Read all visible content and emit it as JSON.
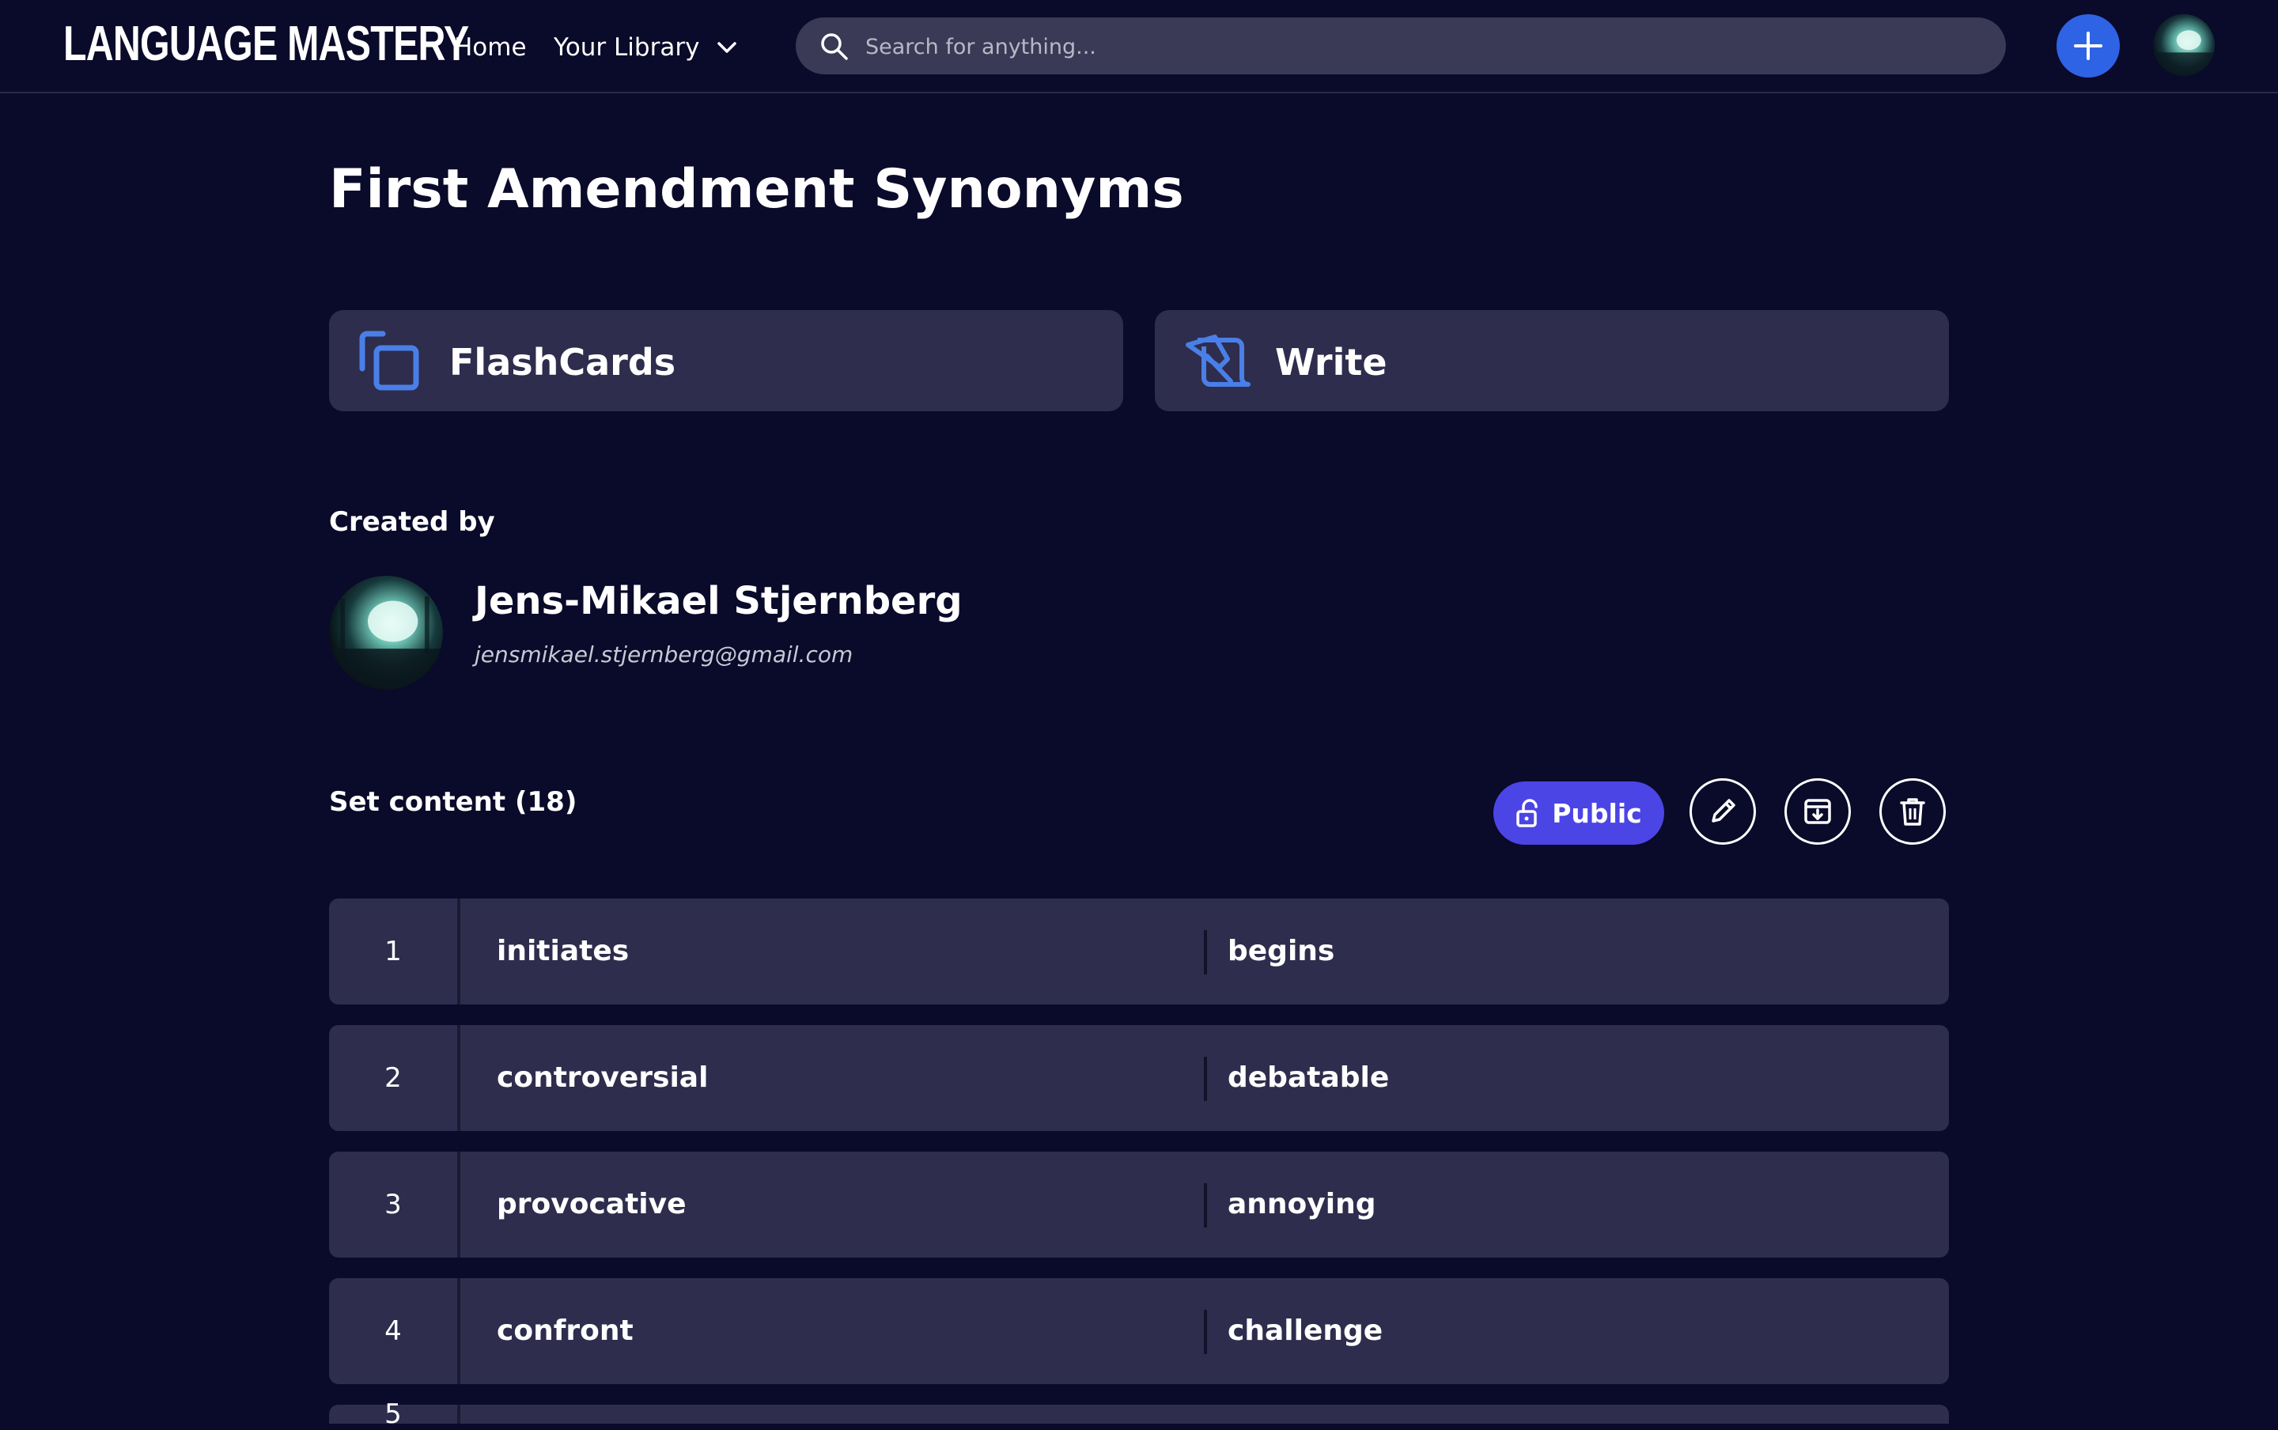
{
  "header": {
    "logo": "LANGUAGE MASTERY",
    "nav": {
      "home": "Home",
      "library": "Your Library"
    },
    "search": {
      "placeholder": "Search for anything..."
    }
  },
  "set": {
    "title": "First Amendment Synonyms",
    "modes": [
      {
        "label": "FlashCards",
        "icon": "flashcards-icon"
      },
      {
        "label": "Write",
        "icon": "write-icon"
      }
    ],
    "created_by_label": "Created by",
    "author": {
      "name": "Jens-Mikael Stjernberg",
      "email": "jensmikael.stjernberg@gmail.com"
    },
    "content_label": "Set content (18)",
    "visibility_label": "Public",
    "terms": [
      {
        "num": "1",
        "term": "initiates",
        "definition": "begins"
      },
      {
        "num": "2",
        "term": "controversial",
        "definition": "debatable"
      },
      {
        "num": "3",
        "term": "provocative",
        "definition": "annoying"
      },
      {
        "num": "4",
        "term": "confront",
        "definition": "challenge"
      },
      {
        "num": "5",
        "term": "",
        "definition": ""
      }
    ]
  },
  "colors": {
    "background": "#0a0a2a",
    "card": "#2e2d4d",
    "accent_blue": "#2f63e6",
    "public_button": "#4b45e6",
    "icon_blue": "#4a7fe8"
  }
}
